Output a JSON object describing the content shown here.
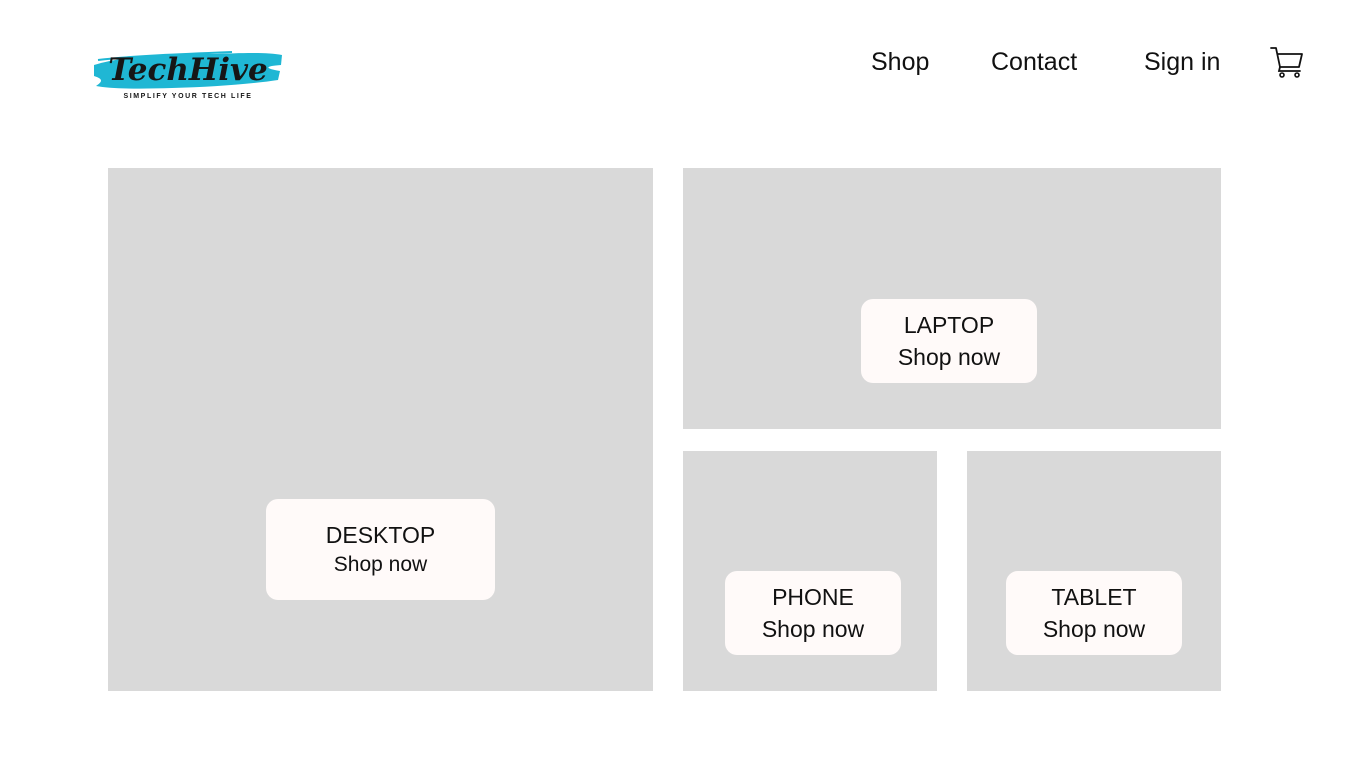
{
  "header": {
    "logo": {
      "wordmark": "TechHive",
      "tagline": "SIMPLIFY YOUR TECH LIFE",
      "brand_color": "#1fb7d4"
    },
    "nav": {
      "shop": "Shop",
      "contact": "Contact",
      "sign_in": "Sign in"
    },
    "cart_icon": "shopping-cart-icon"
  },
  "categories": [
    {
      "label": "DESKTOP",
      "cta": "Shop now"
    },
    {
      "label": "LAPTOP",
      "cta": "Shop now"
    },
    {
      "label": "PHONE",
      "cta": "Shop now"
    },
    {
      "label": "TABLET",
      "cta": "Shop now"
    }
  ],
  "colors": {
    "tile_background": "#d9d9d9",
    "card_background": "#fffaf9",
    "text": "#111111"
  }
}
